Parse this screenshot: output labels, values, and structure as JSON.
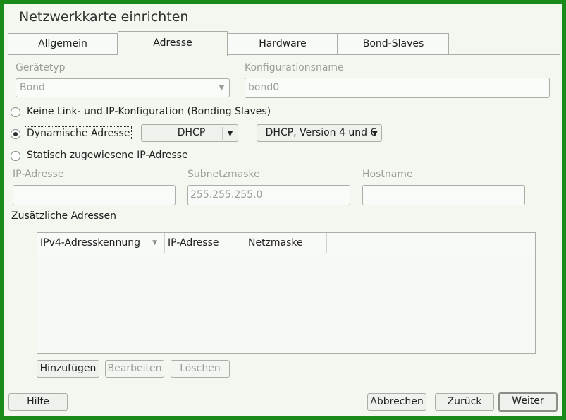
{
  "window": {
    "title": "Netzwerkkarte einrichten"
  },
  "tabs": [
    {
      "label": "Allgemein"
    },
    {
      "label": "Adresse"
    },
    {
      "label": "Hardware"
    },
    {
      "label": "Bond-Slaves"
    }
  ],
  "device_type": {
    "label": "Gerätetyp",
    "value": "Bond"
  },
  "config_name": {
    "label": "Konfigurationsname",
    "value": "bond0"
  },
  "options": {
    "no_link": "Keine Link- und IP-Konfiguration (Bonding Slaves)",
    "dynamic": "Dynamische Adresse",
    "static": "Statisch zugewiesene IP-Adresse"
  },
  "dynamic": {
    "method": "DHCP",
    "version": "DHCP, Version 4 und 6"
  },
  "static": {
    "ip_label": "IP-Adresse",
    "ip_value": "",
    "subnet_label": "Subnetzmaske",
    "subnet_value": "255.255.255.0",
    "hostname_label": "Hostname",
    "hostname_value": ""
  },
  "additional": {
    "heading": "Zusätzliche Adressen",
    "columns": [
      "IPv4-Adresskennung",
      "IP-Adresse",
      "Netzmaske"
    ],
    "rows": [],
    "add": "Hinzufügen",
    "edit": "Bearbeiten",
    "delete": "Löschen"
  },
  "footer": {
    "help": "Hilfe",
    "cancel": "Abbrechen",
    "back": "Zurück",
    "next": "Weiter"
  }
}
